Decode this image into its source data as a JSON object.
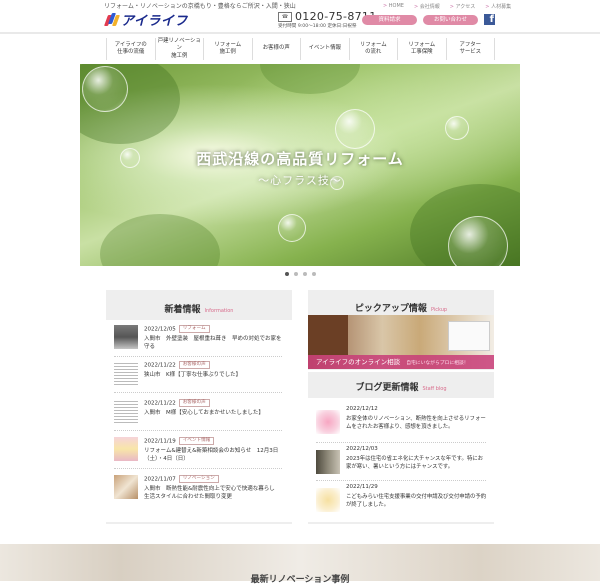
{
  "header": {
    "tagline": "リフォーム・リノベーションの京橋もり・豊格ならご所沢・入間・狭山",
    "logo_text": "アイライフ",
    "top_links": [
      "HOME",
      "会社情報",
      "アクセス",
      "人材募集"
    ],
    "tel_number": "0120-75-8711",
    "tel_hours": "受付時間 9:00〜18:00 定休日:日祝祭",
    "catalog_button": "資料請求",
    "contact_button": "お問い合わせ",
    "facebook_icon": "facebook-icon"
  },
  "nav": {
    "items": [
      {
        "label": "アイライフの\n仕事の流儀"
      },
      {
        "label": "戸建リノベーション\n施工例"
      },
      {
        "label": "リフォーム\n施工例"
      },
      {
        "label": "お客様の声"
      },
      {
        "label": "イベント情報"
      },
      {
        "label": "リフォーム\nの流れ"
      },
      {
        "label": "リフォーム\n工事保険"
      },
      {
        "label": "アフター\nサービス"
      }
    ]
  },
  "hero": {
    "title": "西武沿線の高品質リフォーム",
    "subtitle": "〜心フラス技〜",
    "slide_count": 4,
    "active_slide": 1
  },
  "news": {
    "title": "新着情報",
    "title_en": "Information",
    "items": [
      {
        "date": "2022/12/05",
        "tag": "リフォーム",
        "text": "入間市　外壁塗装　屋根重ね葺き　早めの対処でお家を守る"
      },
      {
        "date": "2022/11/22",
        "tag": "お客様の声",
        "text": "狭山市　K様【丁寧な仕事ぶりでした】"
      },
      {
        "date": "2022/11/22",
        "tag": "お客様の声",
        "text": "入間市　M様【安心しておまかせいたしました】"
      },
      {
        "date": "2022/11/19",
        "tag": "イベント情報",
        "text": "リフォーム&建替え&新築相談会のお知らせ　12月3日（土）・4日（日）"
      },
      {
        "date": "2022/11/07",
        "tag": "リノベーション",
        "text": "入間市　断熱性能&耐震性向上で安心で快適な暮らし　生活スタイルに合わせた間取り変更"
      }
    ]
  },
  "pickup": {
    "title": "ピックアップ情報",
    "title_en": "Pickup",
    "banner_text": "アイライフのオンライン相談",
    "banner_sub": "自宅にいながらプロに相談！"
  },
  "blog": {
    "title": "ブログ更新情報",
    "title_en": "Staff blog",
    "items": [
      {
        "date": "2022/12/12",
        "text": "お家全体のリノベーション、断熱性を向上させるリフォームをされたお客様より、感想を頂きました。"
      },
      {
        "date": "2022/12/03",
        "text": "2023年は住宅の省エネ化に大チャンスな年です。特にお家が寒い、暑いという方にはチャンスです。"
      },
      {
        "date": "2022/11/29",
        "text": "こどもみらい住宅支援事業の交付申請及び交付申請の予約が終了しました。"
      }
    ]
  },
  "footer_section": {
    "title": "最新リノベーション事例"
  }
}
